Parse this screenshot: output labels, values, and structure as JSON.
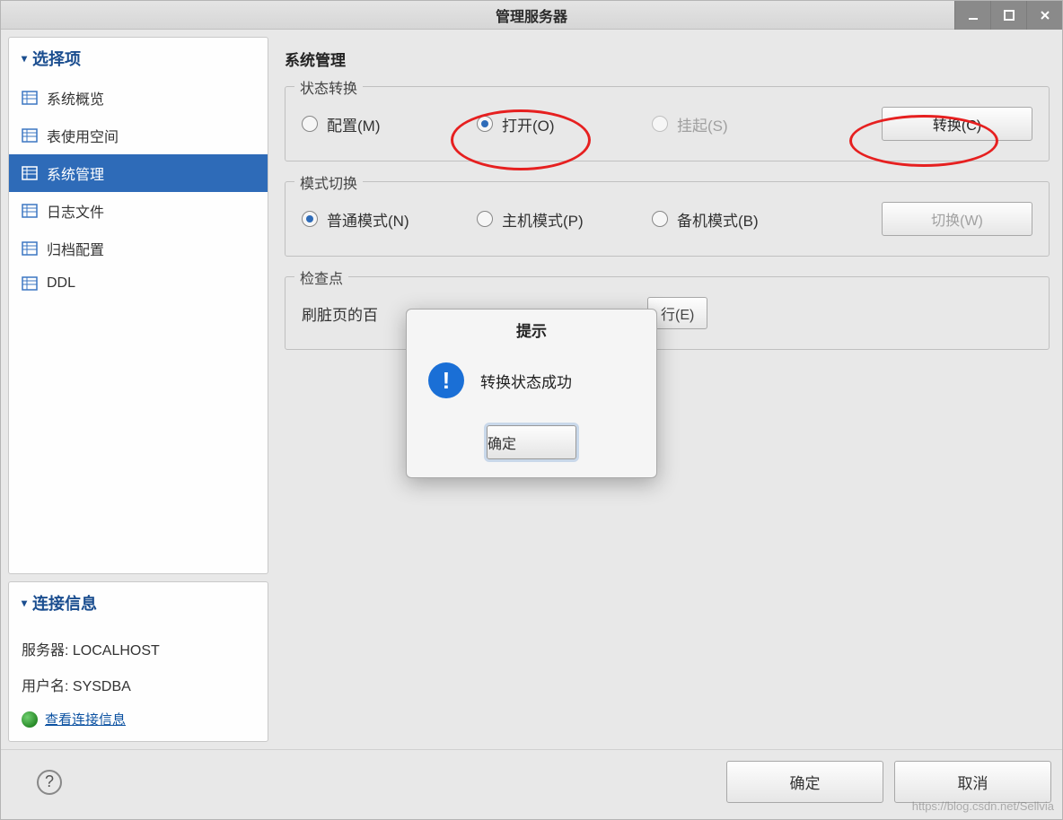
{
  "window": {
    "title": "管理服务器"
  },
  "sidebar": {
    "options_header": "选择项",
    "items": [
      {
        "label": "系统概览"
      },
      {
        "label": "表使用空间"
      },
      {
        "label": "系统管理"
      },
      {
        "label": "日志文件"
      },
      {
        "label": "归档配置"
      },
      {
        "label": "DDL"
      }
    ],
    "connection_header": "连接信息",
    "server_label": "服务器: ",
    "server_value": "LOCALHOST",
    "user_label": "用户名: ",
    "user_value": "SYSDBA",
    "view_link": "查看连接信息"
  },
  "main": {
    "title": "系统管理",
    "state": {
      "legend": "状态转换",
      "opts": {
        "config": "配置(M)",
        "open": "打开(O)",
        "suspend": "挂起(S)"
      },
      "convert_btn": "转换(C)"
    },
    "mode": {
      "legend": "模式切换",
      "opts": {
        "normal": "普通模式(N)",
        "master": "主机模式(P)",
        "standby": "备机模式(B)"
      },
      "switch_btn": "切换(W)"
    },
    "checkpoint": {
      "legend": "检查点",
      "label_partial": "刷脏页的百",
      "exec_btn_partial": "行(E)"
    }
  },
  "dialog": {
    "title": "提示",
    "message": "转换状态成功",
    "ok": "确定"
  },
  "footer": {
    "help": "?",
    "ok": "确定",
    "cancel": "取消"
  },
  "watermark": "https://blog.csdn.net/Sellvia"
}
